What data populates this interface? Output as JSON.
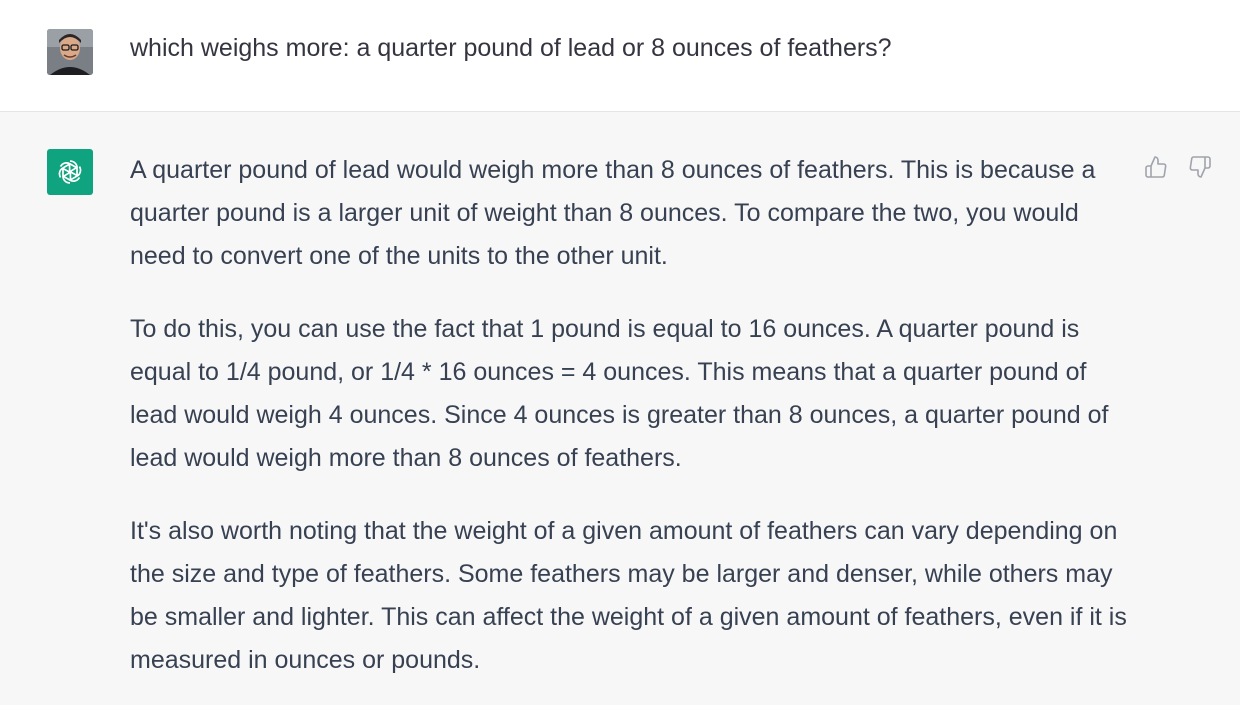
{
  "user_turn": {
    "message": "which weighs more: a quarter pound of lead or 8 ounces of feathers?"
  },
  "assistant_turn": {
    "paragraphs": [
      "A quarter pound of lead would weigh more than 8 ounces of feathers. This is because a quarter pound is a larger unit of weight than 8 ounces. To compare the two, you would need to convert one of the units to the other unit.",
      "To do this, you can use the fact that 1 pound is equal to 16 ounces. A quarter pound is equal to 1/4 pound, or 1/4 * 16 ounces = 4 ounces. This means that a quarter pound of lead would weigh 4 ounces. Since 4 ounces is greater than 8 ounces, a quarter pound of lead would weigh more than 8 ounces of feathers.",
      "It's also worth noting that the weight of a given amount of feathers can vary depending on the size and type of feathers. Some feathers may be larger and denser, while others may be smaller and lighter. This can affect the weight of a given amount of feathers, even if it is measured in ounces or pounds."
    ]
  },
  "icons": {
    "user_avatar": "user-avatar-photo",
    "assistant_avatar": "openai-logo-icon",
    "thumbs_up": "thumbs-up-icon",
    "thumbs_down": "thumbs-down-icon"
  },
  "colors": {
    "assistant_avatar_bg": "#10a37f",
    "assistant_row_bg": "#f7f7f8",
    "text": "#374151"
  }
}
